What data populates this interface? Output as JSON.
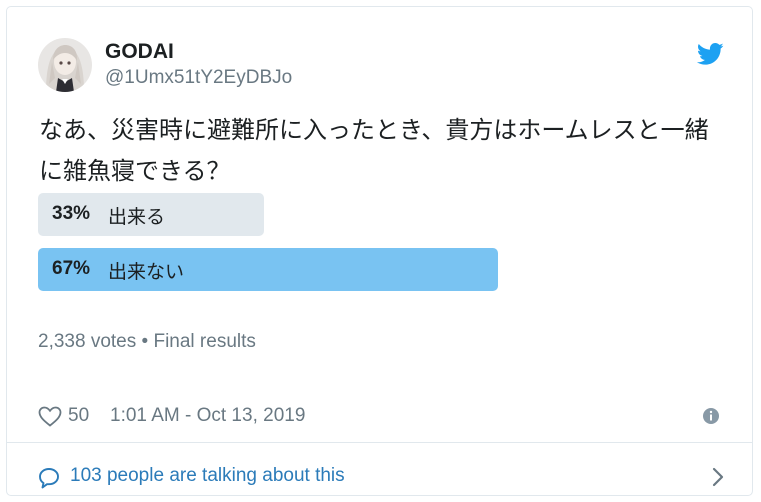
{
  "user": {
    "display_name": "GODAI",
    "handle": "@1Umx51tY2EyDBJo",
    "avatar_icon": "anime-avatar"
  },
  "tweet": {
    "text": "なあ、災害時に避難所に入ったとき、貴方はホームレスと一緒に雑魚寝できる？"
  },
  "poll": {
    "choices": [
      {
        "percent": "33%",
        "label": "出来る",
        "fraction": 0.33,
        "winner": false
      },
      {
        "percent": "67%",
        "label": "出来ない",
        "fraction": 0.67,
        "winner": true
      }
    ],
    "votes": "2,338 votes",
    "separator": "•",
    "status": "Final results"
  },
  "footer": {
    "like_count": "50",
    "timestamp": "1:01 AM - Oct 13, 2019",
    "conversation": "103 people are talking about this"
  },
  "colors": {
    "loser_bar": "#e1e8ed",
    "winner_bar": "#79c3f2",
    "brand": "#1da1f2",
    "link": "#2b7bb9",
    "muted": "#697882"
  }
}
